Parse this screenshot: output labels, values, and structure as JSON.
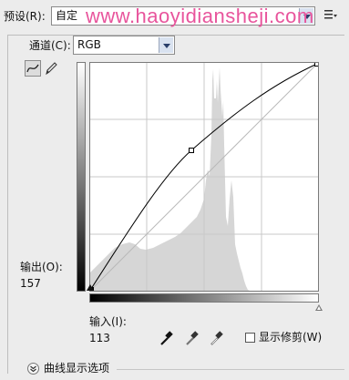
{
  "preset": {
    "label": "预设(R):",
    "value": "自定"
  },
  "watermark": "www.haoyidiansheji.com",
  "channel": {
    "label": "通道(C):",
    "value": "RGB"
  },
  "output": {
    "label": "输出(O):",
    "value": "157"
  },
  "input": {
    "label": "输入(I):",
    "value": "113"
  },
  "show_clipping": {
    "label": "显示修剪(W)",
    "checked": false
  },
  "curve_display": {
    "label": "曲线显示选项"
  },
  "curve_point": {
    "input": 113,
    "output": 157
  },
  "icons": [
    "curve-tool-icon",
    "pencil-icon",
    "black-point-eyedropper-icon",
    "gray-point-eyedropper-icon",
    "white-point-eyedropper-icon",
    "preset-options-icon",
    "expand-chevron-icon"
  ]
}
